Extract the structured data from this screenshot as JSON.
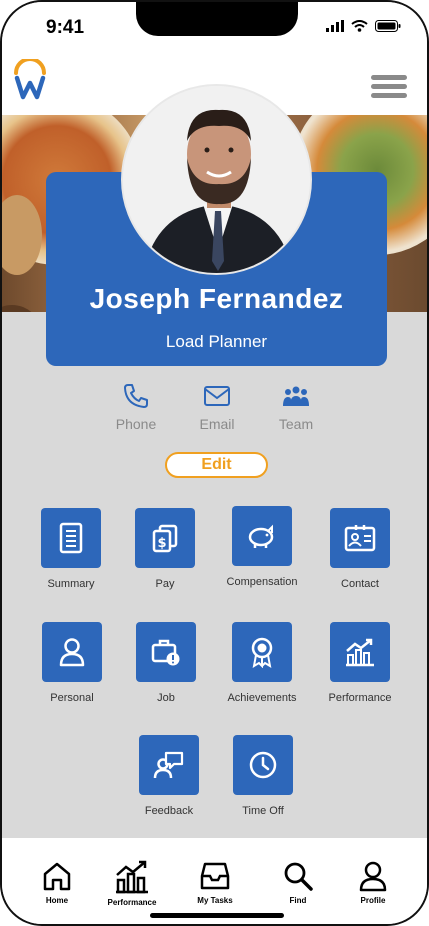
{
  "status": {
    "time": "9:41"
  },
  "profile": {
    "name": "Joseph Fernandez",
    "role": "Load Planner"
  },
  "contacts": [
    {
      "label": "Phone",
      "icon": "phone-icon"
    },
    {
      "label": "Email",
      "icon": "email-icon"
    },
    {
      "label": "Team",
      "icon": "team-icon"
    }
  ],
  "edit_label": "Edit",
  "tiles": [
    {
      "label": "Summary",
      "icon": "document-icon"
    },
    {
      "label": "Pay",
      "icon": "pay-icon"
    },
    {
      "label": "Compensation",
      "icon": "piggy-bank-icon"
    },
    {
      "label": "Contact",
      "icon": "contact-card-icon"
    },
    {
      "label": "Personal",
      "icon": "person-icon"
    },
    {
      "label": "Job",
      "icon": "briefcase-icon"
    },
    {
      "label": "Achievements",
      "icon": "award-icon"
    },
    {
      "label": "Performance",
      "icon": "chart-icon"
    },
    {
      "label": "Feedback",
      "icon": "feedback-icon"
    },
    {
      "label": "Time Off",
      "icon": "clock-icon"
    }
  ],
  "nav": [
    {
      "label": "Home",
      "icon": "home-icon"
    },
    {
      "label": "Performance",
      "icon": "chart-icon"
    },
    {
      "label": "My Tasks",
      "icon": "inbox-icon"
    },
    {
      "label": "Find",
      "icon": "search-icon"
    },
    {
      "label": "Profile",
      "icon": "profile-icon"
    }
  ],
  "colors": {
    "accent": "#2d67ba",
    "edit": "#f0a020",
    "background": "#d9d9d9"
  }
}
